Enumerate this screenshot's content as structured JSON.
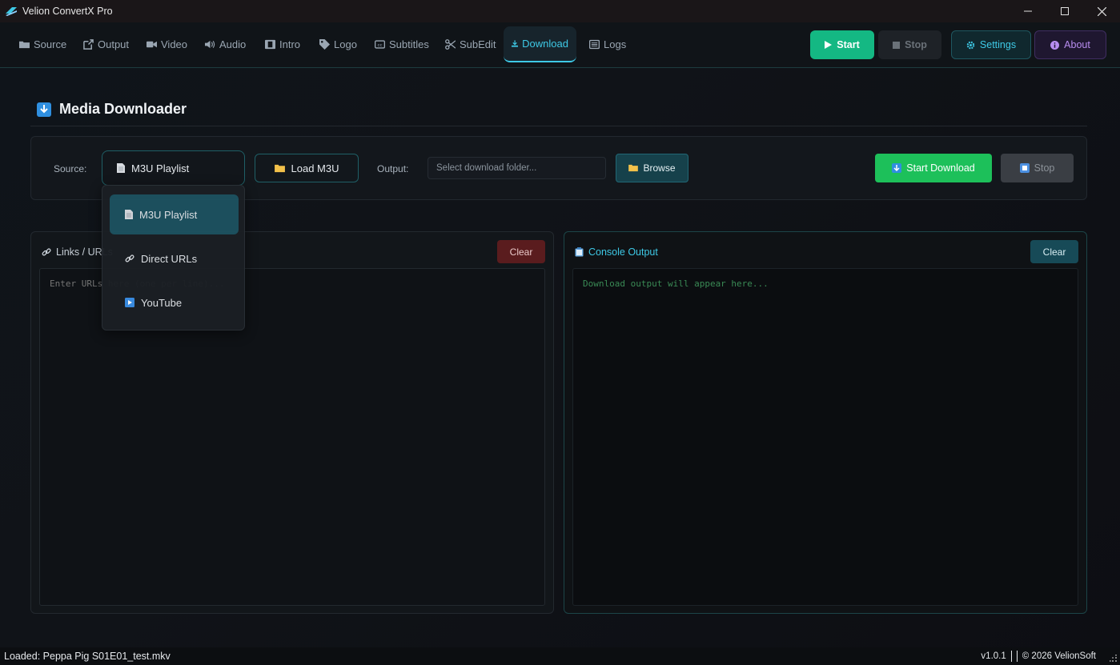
{
  "window": {
    "title": "Velion ConvertX Pro"
  },
  "nav": {
    "tabs": [
      {
        "label": "Source",
        "icon": "folder-icon"
      },
      {
        "label": "Output",
        "icon": "external-link-icon"
      },
      {
        "label": "Video",
        "icon": "video-camera-icon"
      },
      {
        "label": "Audio",
        "icon": "speaker-icon"
      },
      {
        "label": "Intro",
        "icon": "film-icon"
      },
      {
        "label": "Logo",
        "icon": "tag-icon"
      },
      {
        "label": "Subtitles",
        "icon": "closed-captions-icon"
      },
      {
        "label": "SubEdit",
        "icon": "scissors-icon"
      },
      {
        "label": "Download",
        "icon": "download-icon",
        "active": true
      },
      {
        "label": "Logs",
        "icon": "list-icon"
      }
    ],
    "start_label": "Start",
    "stop_label": "Stop",
    "settings_label": "Settings",
    "about_label": "About"
  },
  "page": {
    "title": "Media Downloader"
  },
  "controls": {
    "source_label": "Source:",
    "source_value": "M3U Playlist",
    "load_label": "Load M3U",
    "output_label": "Output:",
    "output_placeholder": "Select download folder...",
    "browse_label": "Browse",
    "start_download_label": "Start Download",
    "stop_label": "Stop"
  },
  "dropdown": {
    "options": [
      {
        "label": "M3U Playlist",
        "icon": "document-icon",
        "selected": true
      },
      {
        "label": "Direct URLs",
        "icon": "link-icon"
      },
      {
        "label": "YouTube",
        "icon": "play-icon"
      }
    ]
  },
  "links_panel": {
    "title": "Links / URLs",
    "clear_label": "Clear",
    "placeholder": "Enter URLs here (one per line)..."
  },
  "console_panel": {
    "title": "Console Output",
    "clear_label": "Clear",
    "placeholder": "Download output will appear here..."
  },
  "status": {
    "left": "Loaded: Peppa Pig S01E01_test.mkv",
    "version": "v1.0.1",
    "copyright": "© 2026 VelionSoft"
  },
  "colors": {
    "accent": "#3ec9e6",
    "start_green": "#14b883",
    "download_green": "#1dc05a",
    "clear_red": "#5a1c1e"
  }
}
